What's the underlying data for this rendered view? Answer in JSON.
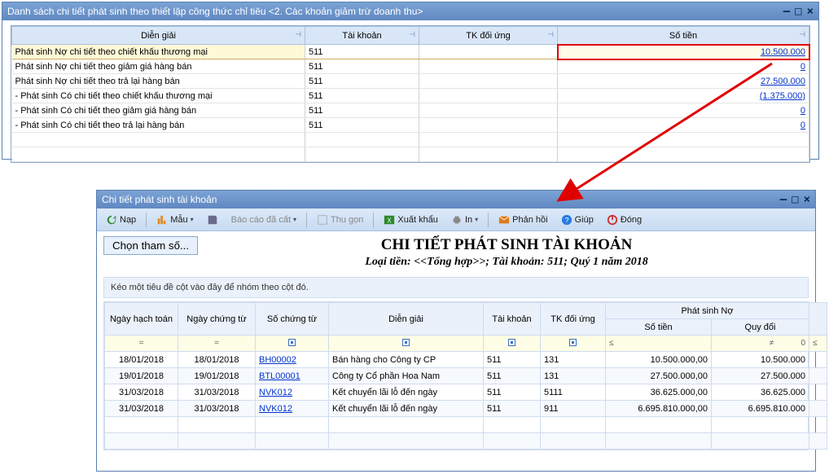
{
  "win1": {
    "title": "Danh sách chi tiết phát sinh theo thiết lập công thức chỉ tiêu <2. Các khoản giảm trừ doanh thu>",
    "columns": {
      "c1": "Diễn giải",
      "c2": "Tài khoản",
      "c3": "TK đối ứng",
      "c4": "Số tiền"
    },
    "rows": [
      {
        "dg": "Phát sinh Nợ chi tiết theo chiết khấu thương mại",
        "tk": "511",
        "tku": "",
        "amt": "10.500.000",
        "hl": true
      },
      {
        "dg": "Phát sinh Nợ chi tiết theo giảm giá hàng bán",
        "tk": "511",
        "tku": "",
        "amt": "0"
      },
      {
        "dg": "Phát sinh Nợ chi tiết theo trả lại hàng bán",
        "tk": "511",
        "tku": "",
        "amt": "27.500.000"
      },
      {
        "dg": "- Phát sinh Có chi tiết theo chiết khấu thương mại",
        "tk": "511",
        "tku": "",
        "amt": "(1.375.000)"
      },
      {
        "dg": "- Phát sinh Có chi tiết theo giảm giá hàng bán",
        "tk": "511",
        "tku": "",
        "amt": "0"
      },
      {
        "dg": "- Phát sinh Có chi tiết theo trả lại hàng bán",
        "tk": "511",
        "tku": "",
        "amt": "0"
      }
    ]
  },
  "win2": {
    "title": "Chi tiết phát sinh tài khoản",
    "toolbar": {
      "nap": "Nạp",
      "mau": "Mẫu",
      "baocao": "Báo cáo đã cất",
      "thugon": "Thu gọn",
      "xuat": "Xuất khẩu",
      "in": "In",
      "phanhoi": "Phản hồi",
      "giup": "Giúp",
      "dong": "Đóng"
    },
    "params_btn": "Chọn tham số...",
    "report_title": "CHI TIẾT PHÁT SINH TÀI KHOẢN",
    "report_sub": "Loại tiền: <<Tổng hợp>>; Tài khoản: 511; Quý 1 năm 2018",
    "groupbar": "Kéo một tiêu đề cột vào đây để nhóm theo cột đó.",
    "headers": {
      "ngayht": "Ngày hạch toán",
      "ngayct": "Ngày chứng từ",
      "so": "Số chứng từ",
      "dg": "Diễn giải",
      "tk": "Tài khoản",
      "tku": "TK đối ứng",
      "psno": "Phát sinh Nợ",
      "st": "Số tiền",
      "qd": "Quy đổi"
    },
    "filter_ops": {
      "eq": "=",
      "le": "≤",
      "ne": "≠",
      "zero": "0"
    },
    "rows": [
      {
        "d1": "18/01/2018",
        "d2": "18/01/2018",
        "so": "BH00002",
        "dg": "Bán hàng cho Công ty CP",
        "tk": "511",
        "tku": "131",
        "st": "10.500.000,00",
        "qd": "10.500.000"
      },
      {
        "d1": "19/01/2018",
        "d2": "19/01/2018",
        "so": "BTL00001",
        "dg": "Công ty Cổ phần Hoa Nam",
        "tk": "511",
        "tku": "131",
        "st": "27.500.000,00",
        "qd": "27.500.000"
      },
      {
        "d1": "31/03/2018",
        "d2": "31/03/2018",
        "so": "NVK012",
        "dg": "Kết chuyển lãi lỗ đến ngày",
        "tk": "511",
        "tku": "5111",
        "st": "36.625.000,00",
        "qd": "36.625.000"
      },
      {
        "d1": "31/03/2018",
        "d2": "31/03/2018",
        "so": "NVK012",
        "dg": "Kết chuyển lãi lỗ đến ngày",
        "tk": "511",
        "tku": "911",
        "st": "6.695.810.000,00",
        "qd": "6.695.810.000"
      }
    ]
  }
}
